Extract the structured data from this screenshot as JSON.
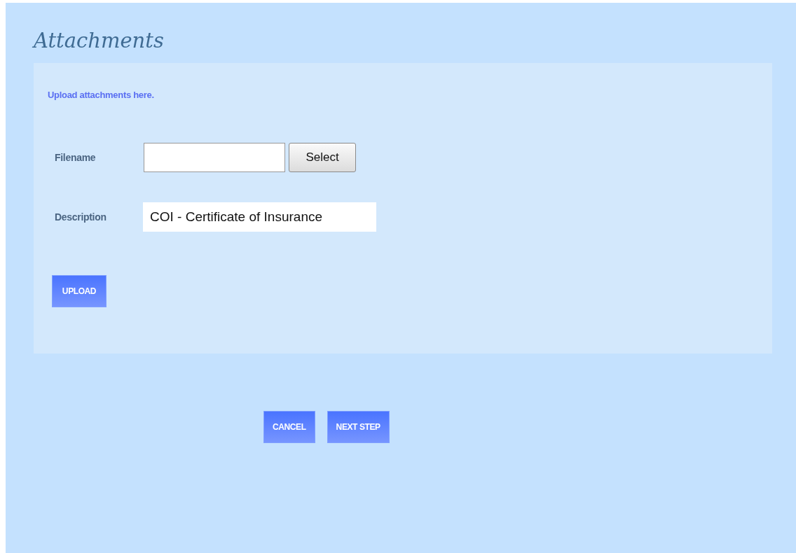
{
  "title": "Attachments",
  "intro": "Upload attachments here.",
  "fields": [
    {
      "label": "Filename",
      "kind": "file",
      "button": "Select"
    },
    {
      "label": "Description",
      "kind": "text",
      "value": "COI - Certificate of Insurance"
    }
  ],
  "upload_button": "UPLOAD",
  "actions": [
    "CANCEL",
    "NEXT STEP"
  ]
}
